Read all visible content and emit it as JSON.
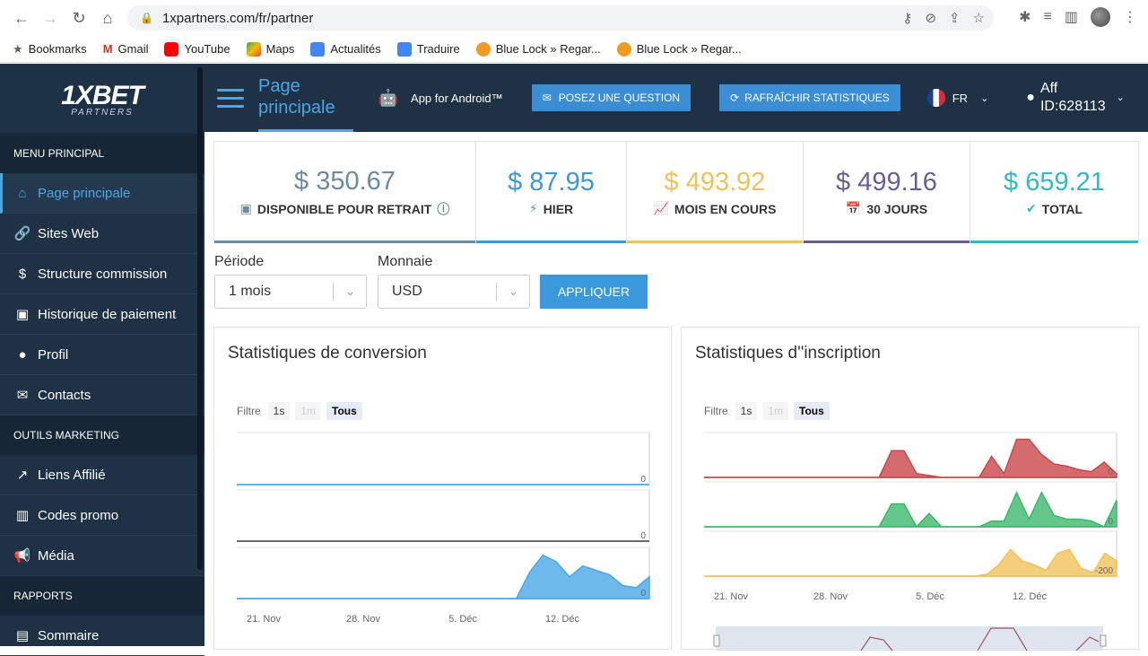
{
  "browser": {
    "url": "1xpartners.com/fr/partner",
    "bookmarks": [
      "Bookmarks",
      "Gmail",
      "YouTube",
      "Maps",
      "Actualités",
      "Traduire",
      "Blue Lock » Regar...",
      "Blue Lock » Regar..."
    ]
  },
  "sidebar": {
    "logo": "1XBET",
    "logo_sub": "PARTNERS",
    "sections": [
      {
        "title": "MENU PRINCIPAL",
        "items": [
          {
            "label": "Page principale",
            "icon": "home-icon",
            "glyph": "⌂",
            "active": true
          },
          {
            "label": "Sites Web",
            "icon": "link-icon",
            "glyph": "🔗",
            "active": false
          },
          {
            "label": "Structure commission",
            "icon": "dollar-icon",
            "glyph": "$",
            "active": false
          },
          {
            "label": "Historique de paiement",
            "icon": "money-icon",
            "glyph": "▣",
            "active": false
          },
          {
            "label": "Profil",
            "icon": "user-icon",
            "glyph": "●",
            "active": false
          },
          {
            "label": "Contacts",
            "icon": "envelope-icon",
            "glyph": "✉",
            "active": false
          }
        ]
      },
      {
        "title": "OUTILS MARKETING",
        "items": [
          {
            "label": "Liens Affilié",
            "icon": "external-link-icon",
            "glyph": "↗",
            "active": false
          },
          {
            "label": "Codes promo",
            "icon": "barcode-icon",
            "glyph": "▥",
            "active": false
          },
          {
            "label": "Média",
            "icon": "bullhorn-icon",
            "glyph": "📢",
            "active": false
          }
        ]
      },
      {
        "title": "RAPPORTS",
        "items": [
          {
            "label": "Sommaire",
            "icon": "summary-icon",
            "glyph": "▤",
            "active": false
          }
        ]
      }
    ]
  },
  "header": {
    "title_line1": "Page",
    "title_line2": "principale",
    "android": "App for Android™",
    "question_btn": "POSEZ UNE QUESTION",
    "refresh_btn": "RAFRAÎCHIR STATISTIQUES",
    "lang": "FR",
    "aff_line1": "Aff",
    "aff_line2": "ID:628113"
  },
  "stats": [
    {
      "value": "$ 350.67",
      "label": "DISPONIBLE POUR RETRAIT",
      "color": "#6b8aa4",
      "bar": "#6b8aa4",
      "icon": "cash-icon",
      "glyph": "▣"
    },
    {
      "value": "$ 87.95",
      "label": "HIER",
      "color": "#3b98da",
      "bar": "#3b98da",
      "icon": "bolt-icon",
      "glyph": "⚡"
    },
    {
      "value": "$ 493.92",
      "label": "MOIS EN COURS",
      "color": "#f0c35a",
      "bar": "#f0c35a",
      "icon": "chart-up-icon",
      "glyph": "📈"
    },
    {
      "value": "$ 499.16",
      "label": "30 JOURS",
      "color": "#6a5f91",
      "bar": "#6a5f91",
      "icon": "calendar-icon",
      "glyph": "📅"
    },
    {
      "value": "$ 659.21",
      "label": "TOTAL",
      "color": "#2fb9c9",
      "bar": "#2fb9c9",
      "icon": "check-icon",
      "glyph": "✔"
    }
  ],
  "form": {
    "period_label": "Période",
    "period_value": "1 mois",
    "currency_label": "Monnaie",
    "currency_value": "USD",
    "apply": "APPLIQUER"
  },
  "panels": {
    "conversion_title": "Statistiques de conversion",
    "inscription_title": "Statistiques d''inscription",
    "filter_label": "Filtre",
    "filter_1s": "1s",
    "filter_1m": "1m",
    "filter_all": "Tous"
  },
  "chart_data": [
    {
      "type": "area",
      "title": "Statistiques de conversion",
      "x_ticks": [
        "21. Nov",
        "28. Nov",
        "5. Déc",
        "12. Déc"
      ],
      "series": [
        {
          "values": [
            0,
            0,
            0,
            0,
            0,
            0,
            0,
            0,
            0,
            0,
            0,
            0,
            0,
            0,
            0,
            0,
            0,
            0,
            0,
            0,
            0,
            0,
            0,
            0,
            0,
            0,
            0,
            0,
            0,
            0
          ],
          "color": "#4aa7e6",
          "end_label": "0"
        },
        {
          "values": [
            0,
            0,
            0,
            0,
            0,
            0,
            0,
            0,
            0,
            0,
            0,
            0,
            0,
            0,
            0,
            0,
            0,
            0,
            0,
            0,
            0,
            0,
            0,
            0,
            0,
            0,
            0,
            0,
            0,
            0
          ],
          "color": "#555555",
          "end_label": "0"
        },
        {
          "values": [
            0,
            0,
            0,
            0,
            0,
            0,
            0,
            0,
            0,
            0,
            0,
            0,
            0,
            0,
            0,
            0,
            0,
            0,
            0,
            0,
            0,
            0,
            0.6,
            1,
            0.85,
            0.5,
            0.75,
            0.65,
            0.55,
            0.3,
            0.25,
            0.5
          ],
          "color": "#4aa7e6",
          "end_label": "0"
        }
      ]
    },
    {
      "type": "area",
      "title": "Statistiques d''inscription",
      "x_ticks": [
        "21. Nov",
        "28. Nov",
        "5. Déc",
        "12. Déc"
      ],
      "series": [
        {
          "values": [
            0,
            0,
            0,
            0,
            0,
            0,
            0,
            0,
            0,
            0,
            0,
            0,
            0,
            0,
            0,
            0.7,
            0.7,
            0.1,
            0.05,
            0,
            0,
            0,
            0,
            0.55,
            0.1,
            1,
            1,
            0.6,
            0.35,
            0.3,
            0.2,
            0.15,
            0.4,
            0.1
          ],
          "color": "#c9474a",
          "end_label": "0"
        },
        {
          "values": [
            0,
            0,
            0,
            0,
            0,
            0,
            0,
            0,
            0,
            0,
            0,
            0,
            0,
            0,
            0,
            0.6,
            0.6,
            0,
            0.35,
            0,
            0,
            0,
            0,
            0.15,
            0.15,
            0.9,
            0.2,
            0.9,
            0.3,
            0.2,
            0.2,
            0.15,
            0,
            0.7
          ],
          "color": "#3bb96b",
          "end_label": "0"
        },
        {
          "values": [
            0,
            0,
            0,
            0,
            0,
            0,
            0,
            0,
            0,
            0,
            0,
            0,
            0,
            0,
            0,
            0,
            0,
            0,
            0,
            0,
            0,
            0,
            0,
            0,
            0.05,
            0.3,
            0.7,
            0.4,
            0.3,
            0.15,
            0.6,
            0.7,
            0.2,
            0.1,
            0.6,
            0.4
          ],
          "color": "#f0c35a",
          "end_label": "-200"
        }
      ]
    }
  ]
}
